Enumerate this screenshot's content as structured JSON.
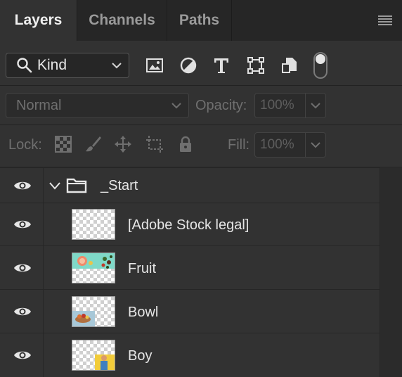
{
  "tabs": [
    {
      "label": "Layers",
      "active": true
    },
    {
      "label": "Channels",
      "active": false
    },
    {
      "label": "Paths",
      "active": false
    }
  ],
  "filter": {
    "kind_label": "Kind",
    "icons": [
      "image-filter-icon",
      "adjustment-filter-icon",
      "type-filter-icon",
      "shape-filter-icon",
      "smart-object-filter-icon"
    ],
    "filter_on": true
  },
  "blend": {
    "mode": "Normal",
    "opacity_label": "Opacity:",
    "opacity_value": "100%"
  },
  "lock": {
    "label": "Lock:",
    "fill_label": "Fill:",
    "fill_value": "100%"
  },
  "layers": [
    {
      "name": "_Start",
      "type": "group",
      "expanded": true,
      "visible": true
    },
    {
      "name": "[Adobe Stock legal]",
      "type": "layer",
      "visible": true
    },
    {
      "name": "Fruit",
      "type": "layer",
      "visible": true
    },
    {
      "name": "Bowl",
      "type": "layer",
      "visible": true
    },
    {
      "name": "Boy",
      "type": "layer",
      "visible": true
    }
  ],
  "colors": {
    "panel_bg": "#323232",
    "tabbar_bg": "#262626",
    "text": "#e6e6e6",
    "dim_text": "#6f6f6f"
  }
}
